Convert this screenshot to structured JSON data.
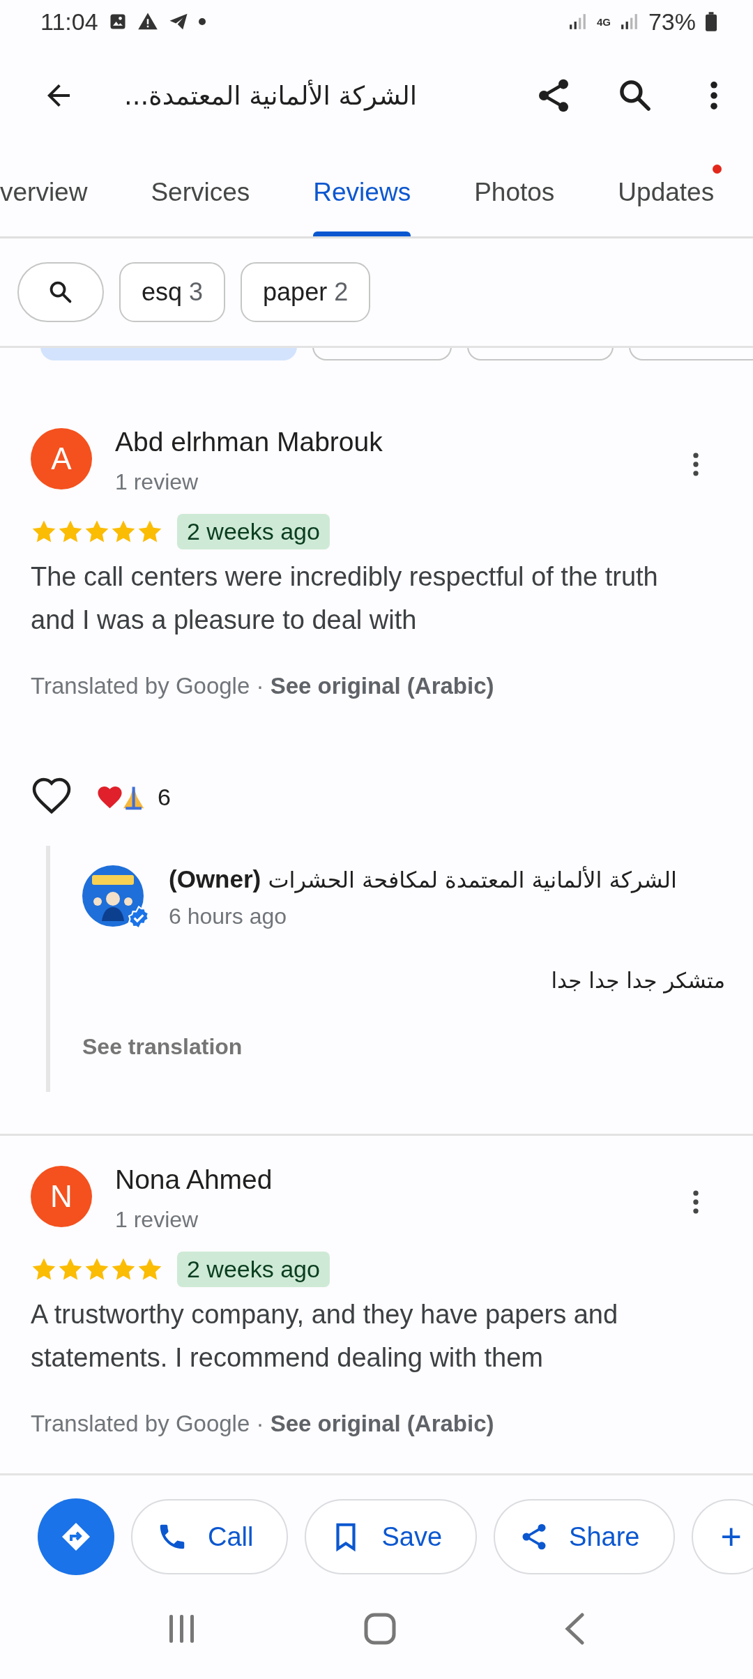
{
  "status_bar": {
    "time": "11:04",
    "network": "4G",
    "battery": "73%"
  },
  "app_bar": {
    "title": "الشركة الألمانية المعتمدة..."
  },
  "tabs": [
    {
      "label": "verview",
      "selected": false,
      "notification_dot": false
    },
    {
      "label": "Services",
      "selected": false,
      "notification_dot": false
    },
    {
      "label": "Reviews",
      "selected": true,
      "notification_dot": false
    },
    {
      "label": "Photos",
      "selected": false,
      "notification_dot": false
    },
    {
      "label": "Updates",
      "selected": false,
      "notification_dot": true
    }
  ],
  "filter_chips": [
    {
      "label": "esq",
      "count": "3"
    },
    {
      "label": "paper",
      "count": "2"
    }
  ],
  "reviews": [
    {
      "avatar_letter": "A",
      "name": "Abd elrhman Mabrouk",
      "review_count": "1 review",
      "stars": 5,
      "time": "2 weeks ago",
      "text": "The call centers were incredibly respectful of the truth and I was a pleasure to deal with",
      "translation_note": "Translated by Google · ",
      "see_original": "See original (Arabic)",
      "reaction_count": "6",
      "owner_reply": {
        "name": "الشركة الألمانية المعتمدة لمكافحة الحشرات **(Owner)**",
        "time": "6 hours ago",
        "text": "متشكر جدا جدا جدا",
        "see_translation": "See translation"
      }
    },
    {
      "avatar_letter": "N",
      "name": "Nona Ahmed",
      "review_count": "1 review",
      "stars": 5,
      "time": "2 weeks ago",
      "text": "A trustworthy company, and they have papers and statements. I recommend dealing with them",
      "translation_note": "Translated by Google · ",
      "see_original": "See original (Arabic)"
    }
  ],
  "actions": [
    {
      "kind": "directions"
    },
    {
      "kind": "call",
      "label": "Call"
    },
    {
      "kind": "save",
      "label": "Save"
    },
    {
      "kind": "share",
      "label": "Share"
    },
    {
      "kind": "more",
      "label": "+"
    }
  ]
}
